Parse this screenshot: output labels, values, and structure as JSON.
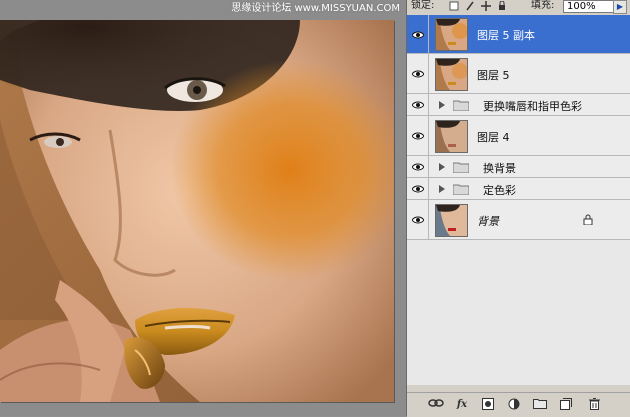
{
  "canvas": {
    "watermark": "思缘设计论坛  www.MISSYUAN.COM"
  },
  "layers_panel": {
    "lock_label": "锁定:",
    "fill_label": "填充:",
    "fill_value": "100%",
    "layers": [
      {
        "name": "图层 5 副本",
        "type": "layer",
        "selected": true,
        "visible": true
      },
      {
        "name": "图层 5",
        "type": "layer",
        "selected": false,
        "visible": true
      },
      {
        "name": "更换嘴唇和指甲色彩",
        "type": "group",
        "selected": false,
        "visible": true
      },
      {
        "name": "图层 4",
        "type": "layer",
        "selected": false,
        "visible": true
      },
      {
        "name": "换背景",
        "type": "group",
        "selected": false,
        "visible": true
      },
      {
        "name": "定色彩",
        "type": "group",
        "selected": false,
        "visible": true
      },
      {
        "name": "背景",
        "type": "background",
        "selected": false,
        "visible": true,
        "locked": true
      }
    ],
    "footer_icons": [
      "link-icon",
      "fx-icon",
      "mask-icon",
      "adjustment-icon",
      "folder-icon",
      "new-layer-icon",
      "trash-icon"
    ],
    "fx_label": "fx"
  },
  "colors": {
    "selection": "#3a6fd0",
    "panel_bg": "#d4d0c8",
    "list_bg": "#ececec",
    "skin": "#d9a784",
    "orange_blush": "#e08a24",
    "lip_gold": "#c98a1e"
  }
}
